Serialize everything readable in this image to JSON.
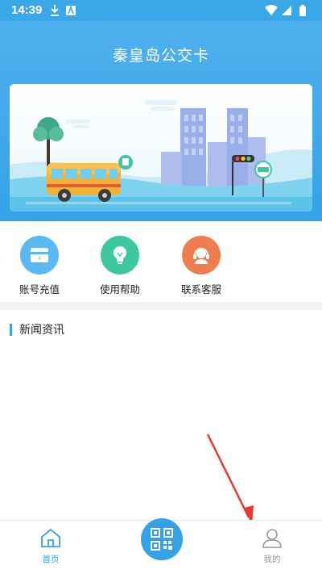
{
  "status_bar": {
    "time": "14:39"
  },
  "header": {
    "title": "秦皇岛公交卡"
  },
  "quick_nav": [
    {
      "label": "账号充值",
      "icon": "recharge-card-icon",
      "color": "#5ab8f3"
    },
    {
      "label": "使用帮助",
      "icon": "lightbulb-icon",
      "color": "#3ec8a0"
    },
    {
      "label": "联系客服",
      "icon": "customer-service-icon",
      "color": "#f07d4e"
    }
  ],
  "news": {
    "title": "新闻资讯"
  },
  "bottom_nav": {
    "home_label": "首页",
    "mine_label": "我的",
    "scan_icon": "qr-code-icon"
  },
  "colors": {
    "accent": "#35a2e7"
  }
}
